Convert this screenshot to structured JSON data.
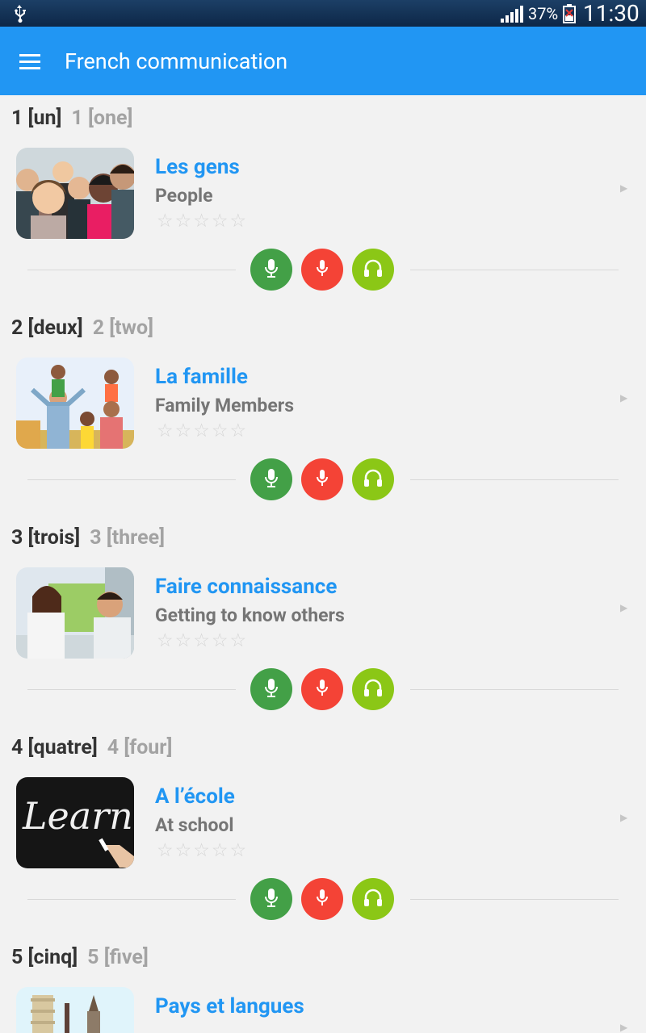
{
  "status_bar": {
    "battery": "37%",
    "time": "11:30"
  },
  "app_bar": {
    "title": "French communication"
  },
  "colors": {
    "accent": "#2196f3",
    "speak": "#43a047",
    "record": "#f44336",
    "listen": "#8bc716"
  },
  "lessons": [
    {
      "num_fr": "1 [un]",
      "num_en": "1 [one]",
      "title": "Les gens",
      "subtitle": "People",
      "stars": "☆☆☆☆☆"
    },
    {
      "num_fr": "2 [deux]",
      "num_en": "2 [two]",
      "title": "La famille",
      "subtitle": "Family Members",
      "stars": "☆☆☆☆☆"
    },
    {
      "num_fr": "3 [trois]",
      "num_en": "3 [three]",
      "title": "Faire connaissance",
      "subtitle": "Getting to know others",
      "stars": "☆☆☆☆☆"
    },
    {
      "num_fr": "4 [quatre]",
      "num_en": "4 [four]",
      "title": "A l’école",
      "subtitle": "At school",
      "stars": "☆☆☆☆☆"
    },
    {
      "num_fr": "5 [cinq]",
      "num_en": "5 [five]",
      "title": "Pays et langues",
      "subtitle": "",
      "stars": ""
    }
  ],
  "thumb4": {
    "text": "Learn"
  },
  "icons": [
    "usb-icon",
    "signal-icon",
    "battery-icon",
    "menu-icon",
    "microphone-icon",
    "record-icon",
    "headphones-icon",
    "chevron-right-icon"
  ]
}
